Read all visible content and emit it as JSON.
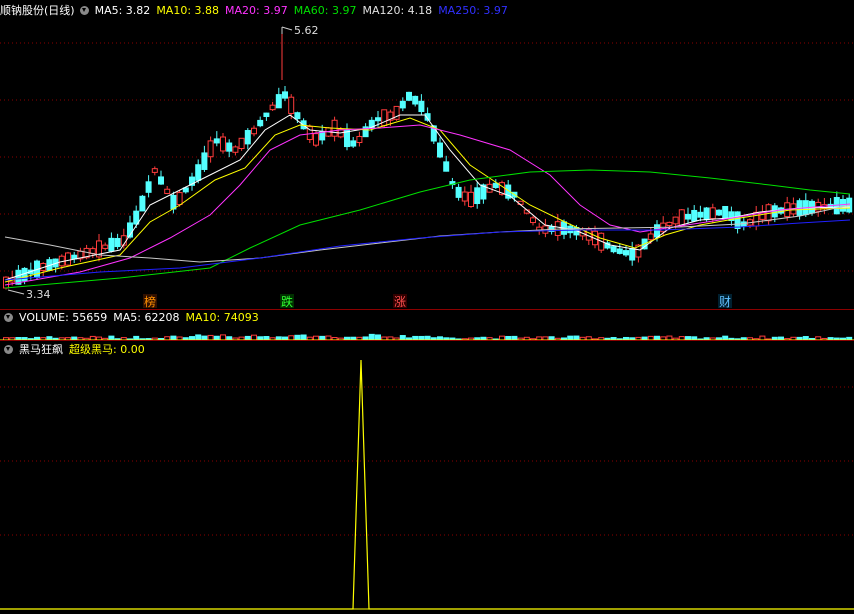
{
  "main_header": {
    "title": "顺钠股份(日线)",
    "ma5": "MA5: 3.82",
    "ma10": "MA10: 3.88",
    "ma20": "MA20: 3.97",
    "ma60": "MA60: 3.97",
    "ma120": "MA120: 4.18",
    "ma250": "MA250: 3.97"
  },
  "price_labels": {
    "high": "5.62",
    "low": "3.34"
  },
  "event_markers": [
    "榜",
    "跌",
    "涨",
    "财"
  ],
  "volume_header": {
    "title": "VOLUME: 55659",
    "ma5": "MA5: 62208",
    "ma10": "MA10: 74093"
  },
  "indicator_header": {
    "title": "黑马狂飙",
    "line": "超级黑马: 0.00"
  },
  "colors": {
    "up": "#ff3c3c",
    "down": "#54ffff",
    "ma5": "#ffffff",
    "ma10": "#ffff00",
    "ma20": "#ff33ff",
    "ma60": "#00e000",
    "ma120": "#c8c8c8",
    "ma250": "#2020ff",
    "grid": "#8b0000",
    "signal": "#ffff00"
  }
}
